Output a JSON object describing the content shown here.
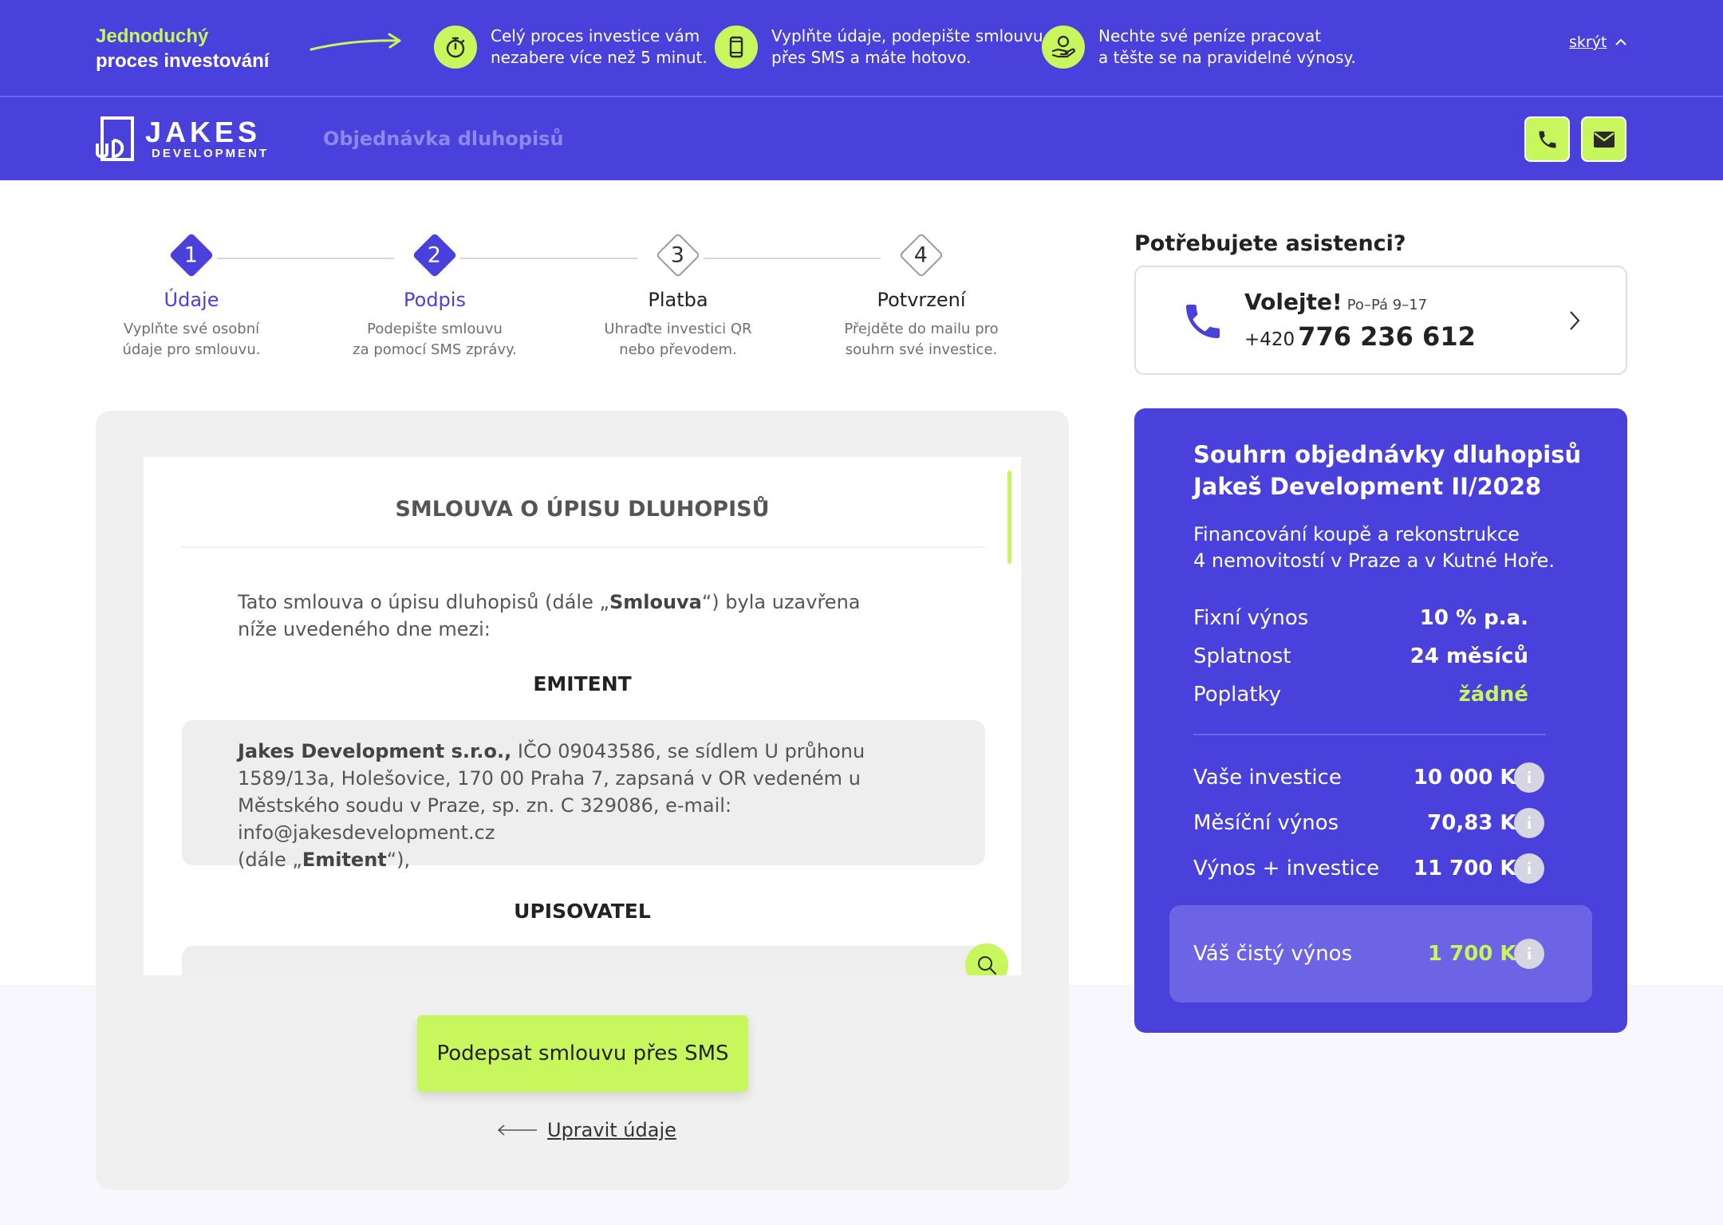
{
  "promo": {
    "title_line1": "Jednoduchý",
    "title_line2": "proces investování",
    "features": [
      {
        "icon": "stopwatch-icon",
        "line1": "Celý proces investice vám",
        "line2": "nezabere více než 5 minut."
      },
      {
        "icon": "smartphone-icon",
        "line1": "Vyplňte údaje, podepište smlouvu",
        "line2": "přes SMS a máte hotovo."
      },
      {
        "icon": "hand-money-icon",
        "line1": "Nechte své peníze pracovat",
        "line2": "a těšte se na pravidelné výnosy."
      }
    ],
    "hide_label": "skrýt"
  },
  "nav": {
    "logo_big": "JAKES",
    "logo_small": "DEVELOPMENT",
    "logo_mark": "JD",
    "page_title": "Objednávka dluhopisů"
  },
  "steps": [
    {
      "number": "1",
      "title": "Údaje",
      "desc1": "Vyplňte své osobní",
      "desc2": "údaje pro smlouvu.",
      "active": true
    },
    {
      "number": "2",
      "title": "Podpis",
      "desc1": "Podepište smlouvu",
      "desc2": "za pomocí SMS zprávy.",
      "active": true
    },
    {
      "number": "3",
      "title": "Platba",
      "desc1": "Uhraďte investici QR",
      "desc2": "nebo převodem.",
      "active": false
    },
    {
      "number": "4",
      "title": "Potvrzení",
      "desc1": "Přejděte do mailu pro",
      "desc2": "souhrn své investice.",
      "active": false
    }
  ],
  "contract": {
    "title": "SMLOUVA O ÚPISU DLUHOPISŮ",
    "intro_pre": "Tato smlouva o úpisu dluhopisů (dále „",
    "intro_bold": "Smlouva",
    "intro_post": "“) byla uzavřena níže uvedeného dne mezi:",
    "issuer_heading": "EMITENT",
    "issuer_name": "Jakes Development s.r.o.,",
    "issuer_text": " IČO 09043586, se sídlem U průhonu 1589/13a, Holešovice, 170 00 Praha 7, zapsaná v OR vedeném u Městského soudu v Praze, sp. zn. C 329086, e-mail: info@jakesdevelopment.cz",
    "issuer_alias_pre": "(dále „",
    "issuer_alias_bold": "Emitent",
    "issuer_alias_post": "“),",
    "subscriber_heading": "UPISOVATEL"
  },
  "actions": {
    "sign_label": "Podepsat smlouvu přes SMS",
    "back_label": "Upravit údaje"
  },
  "assist": {
    "heading": "Potřebujete asistenci?",
    "call_label": "Volejte!",
    "hours": "Po–Pá 9–17",
    "prefix": "+420",
    "number": "776 236 612"
  },
  "summary": {
    "title_line1": "Souhrn objednávky dluhopisů",
    "title_line2": "Jakeš Development II/2028",
    "desc_line1": "Financování koupě a rekonstrukce",
    "desc_line2": "4 nemovitostí v Praze a v Kutné Hoře.",
    "terms": [
      {
        "label": "Fixní výnos",
        "value": "10 % p.a."
      },
      {
        "label": "Splatnost",
        "value": "24 měsíců"
      },
      {
        "label": "Poplatky",
        "value": "žádné"
      }
    ],
    "amounts": [
      {
        "label": "Vaše investice",
        "value": "10 000 Kč"
      },
      {
        "label": "Měsíční výnos",
        "value": "70,83 Kč"
      },
      {
        "label": "Výnos + investice",
        "value": "11 700 Kč"
      }
    ],
    "net_label": "Váš čistý výnos",
    "net_value": "1 700 Kč",
    "info_glyph": "i"
  },
  "colors": {
    "primary": "#4a40db",
    "accent": "#c8f65d",
    "net_box": "#6c63e5"
  }
}
